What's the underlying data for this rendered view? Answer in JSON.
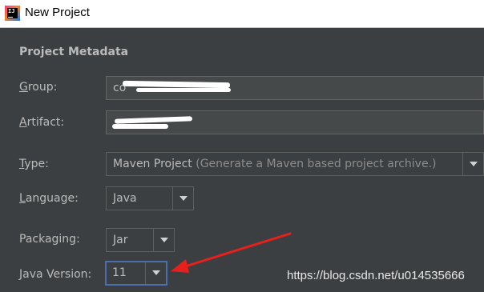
{
  "window": {
    "title": "New Project",
    "app_icon_text": "IJ"
  },
  "form": {
    "section_title": "Project Metadata",
    "group": {
      "label": "Group:",
      "mnemonic": "G",
      "rest": "roup:",
      "value_visible": "co"
    },
    "artifact": {
      "label": "Artifact:",
      "mnemonic": "A",
      "rest": "rtifact:"
    },
    "type": {
      "label": "Type:",
      "mnemonic": "T",
      "rest": "ype:",
      "value": "Maven Project",
      "hint": "(Generate a Maven based project archive.)"
    },
    "language": {
      "label": "Language:",
      "mnemonic": "L",
      "rest": "anguage:",
      "value": "Java"
    },
    "packaging": {
      "label": "Packaging:",
      "value": "Jar"
    },
    "java_version": {
      "label": "Java Version:",
      "mnemonic": "J",
      "rest": "ava Version:",
      "value": "11"
    }
  },
  "annotation": {
    "arrow_color": "#e8201c",
    "watermark": "https://blog.csdn.net/u014535666"
  },
  "icons": {
    "app": "intellij-idea-icon",
    "dropdown": "chevron-down-icon"
  }
}
